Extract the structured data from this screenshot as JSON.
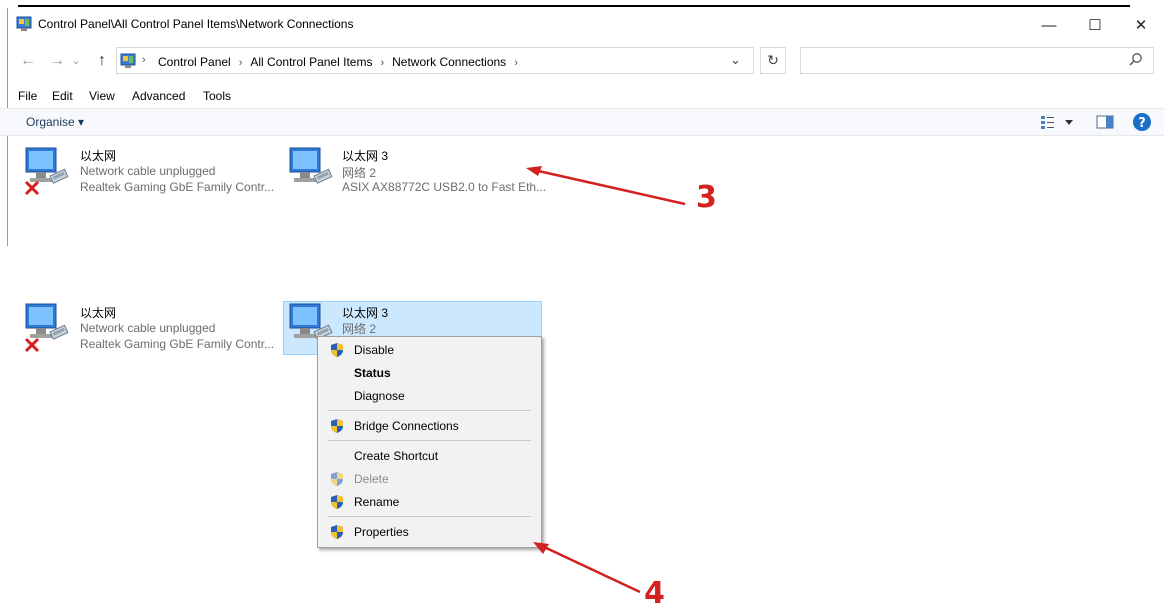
{
  "window": {
    "title": "Control Panel\\All Control Panel Items\\Network Connections",
    "controls": {
      "minimize": "—",
      "maximize": "☐",
      "close": "✕"
    }
  },
  "nav": {
    "back": "←",
    "forward": "→",
    "dropdown": "⌄",
    "up": "↑",
    "address_crumbs": [
      "Control Panel",
      "All Control Panel Items",
      "Network Connections"
    ],
    "crumb_separator": "›",
    "address_dropdown": "⌄",
    "refresh": "↻",
    "search_placeholder": ""
  },
  "menubar": [
    "File",
    "Edit",
    "View",
    "Advanced",
    "Tools"
  ],
  "commandbar": {
    "organise": "Organise ▾"
  },
  "top_panel": {
    "items": [
      {
        "name": "以太网",
        "status": "Network cable unplugged",
        "device": "Realtek Gaming GbE Family Contr...",
        "disconnected": true
      },
      {
        "name": "以太网 3",
        "status": "网络 2",
        "device": "ASIX AX88772C USB2.0 to Fast Eth...",
        "disconnected": false
      }
    ],
    "annotation": "3"
  },
  "bottom_panel": {
    "items": [
      {
        "name": "以太网",
        "status": "Network cable unplugged",
        "device": "Realtek Gaming GbE Family Contr...",
        "disconnected": true
      },
      {
        "name": "以太网 3",
        "status": "网络 2",
        "selected": true
      }
    ],
    "context_menu": [
      {
        "label": "Disable",
        "shield": true,
        "bold": false,
        "disabled": false
      },
      {
        "label": "Status",
        "shield": false,
        "bold": true,
        "disabled": false
      },
      {
        "label": "Diagnose",
        "shield": false,
        "bold": false,
        "disabled": false
      },
      {
        "label": "Bridge Connections",
        "shield": true,
        "bold": false,
        "disabled": false
      },
      {
        "label": "Create Shortcut",
        "shield": false,
        "bold": false,
        "disabled": false
      },
      {
        "label": "Delete",
        "shield": true,
        "bold": false,
        "disabled": true
      },
      {
        "label": "Rename",
        "shield": true,
        "bold": false,
        "disabled": false
      },
      {
        "label": "Properties",
        "shield": true,
        "bold": false,
        "disabled": false
      }
    ],
    "annotation": "4"
  },
  "colors": {
    "annotation": "#d2211e",
    "selection": "#cce8ff",
    "accent": "#1e395b",
    "help": "#1a6fc9"
  }
}
